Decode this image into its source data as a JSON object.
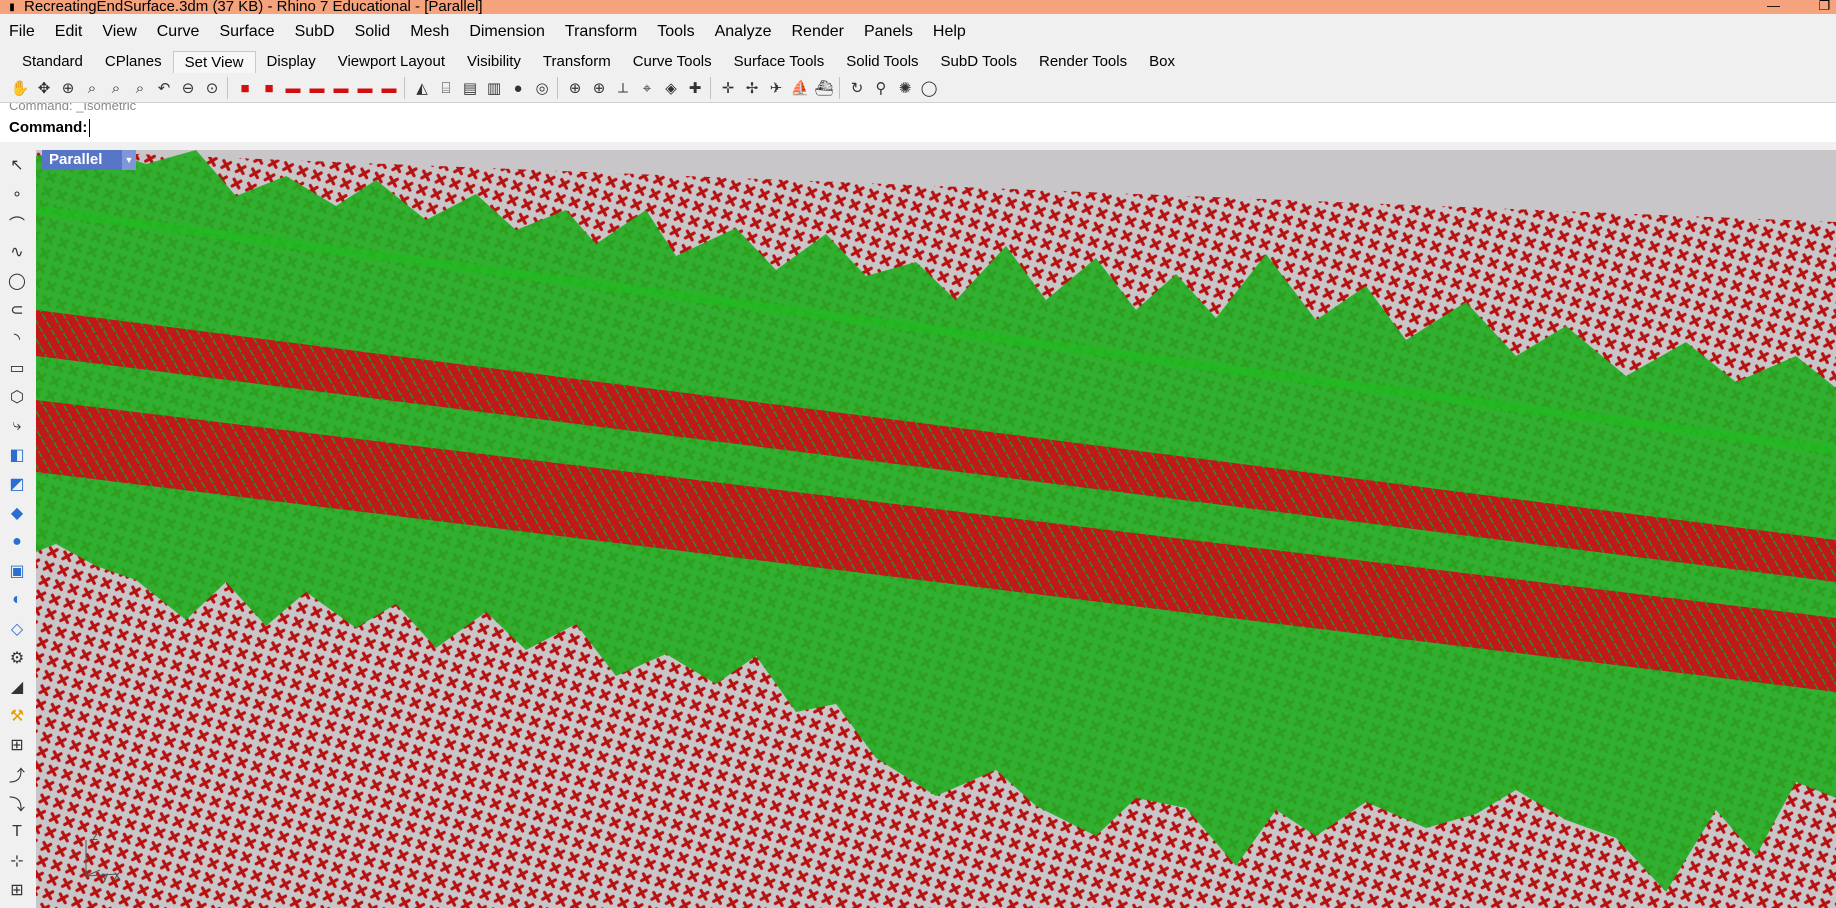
{
  "window": {
    "title": "RecreatingEndSurface.3dm (37 KB) - Rhino 7 Educational - [Parallel]"
  },
  "menu": {
    "items": [
      "File",
      "Edit",
      "View",
      "Curve",
      "Surface",
      "SubD",
      "Solid",
      "Mesh",
      "Dimension",
      "Transform",
      "Tools",
      "Analyze",
      "Render",
      "Panels",
      "Help"
    ]
  },
  "tabs": {
    "items": [
      "Standard",
      "CPlanes",
      "Set View",
      "Display",
      "Viewport Layout",
      "Visibility",
      "Transform",
      "Curve Tools",
      "Surface Tools",
      "Solid Tools",
      "SubD Tools",
      "Render Tools",
      "Box"
    ],
    "active": "Set View"
  },
  "toolbar": {
    "icons": [
      "pan-icon",
      "rotate-view-icon",
      "zoom-dynamic-icon",
      "zoom-window-icon",
      "zoom-extents-icon",
      "zoom-selected-icon",
      "undo-view-icon",
      "zoom-out-icon",
      "zoom-1to1-icon",
      "front-view-icon",
      "back-view-icon",
      "car-left-icon",
      "car-front-icon",
      "car-right-icon",
      "car-back-icon",
      "car-top-icon",
      "perspective-icon",
      "camera-icon",
      "named-view-icon",
      "named-cplane-icon",
      "sphere-view-icon",
      "two-point-icon",
      "target-icon",
      "set-target-icon",
      "camera-lens-icon",
      "place-camera-icon",
      "box-view-icon",
      "plan-view-icon",
      "elevation-icon",
      "plane-icon",
      "airplane-icon",
      "ship-icon",
      "boat-icon",
      "walkabout-icon",
      "walk-icon",
      "light-icon",
      "compass-icon"
    ]
  },
  "command": {
    "history": "Command: _Isometric",
    "prompt": "Command:"
  },
  "viewport": {
    "label": "Parallel",
    "axis_labels": [
      "z",
      "y",
      "x"
    ]
  },
  "colors": {
    "titlebar": "#f5a37c",
    "viewport_bg": "#c9c6c9",
    "control_point_red": "#b50a0a",
    "surface_green": "#1fa81f",
    "viewport_tab": "#5876c8"
  }
}
